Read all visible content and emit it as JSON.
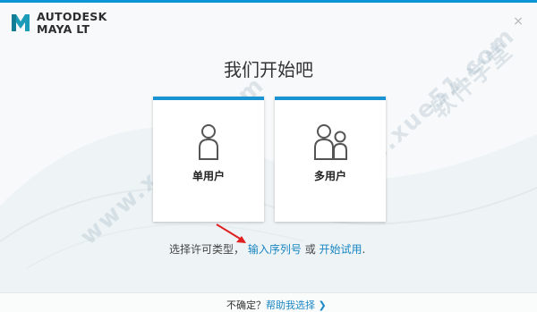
{
  "brand": {
    "line1": "AUTODESK",
    "line2": "MAYA LT",
    "logo_icon": "maya-logo-icon",
    "accent": "#0a96d6"
  },
  "window": {
    "close_symbol": "×"
  },
  "main": {
    "title": "我们开始吧",
    "cards": [
      {
        "label": "单用户",
        "icon": "single-user-icon"
      },
      {
        "label": "多用户",
        "icon": "multi-user-icon"
      }
    ],
    "license_prompt": "选择许可类型，",
    "serial_link": "输入序列号",
    "or_text": "或",
    "trial_link": "开始试用",
    "period": "."
  },
  "footer": {
    "question": "不确定？",
    "help_link": "帮助我选择",
    "chevron": "❯"
  },
  "watermark": {
    "text": "www.xue51.com 软件学堂"
  }
}
